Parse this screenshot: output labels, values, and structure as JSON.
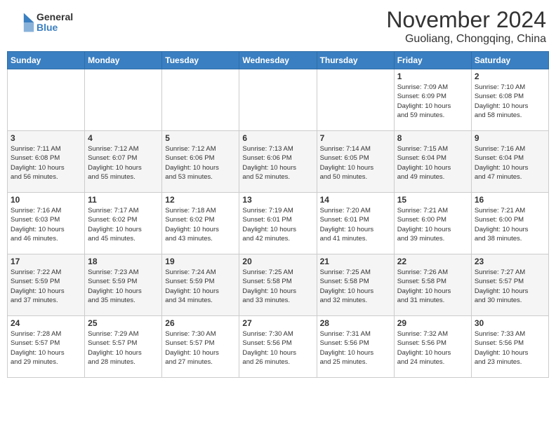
{
  "header": {
    "logo_general": "General",
    "logo_blue": "Blue",
    "month_title": "November 2024",
    "location": "Guoliang, Chongqing, China"
  },
  "weekdays": [
    "Sunday",
    "Monday",
    "Tuesday",
    "Wednesday",
    "Thursday",
    "Friday",
    "Saturday"
  ],
  "weeks": [
    [
      {
        "day": "",
        "info": ""
      },
      {
        "day": "",
        "info": ""
      },
      {
        "day": "",
        "info": ""
      },
      {
        "day": "",
        "info": ""
      },
      {
        "day": "",
        "info": ""
      },
      {
        "day": "1",
        "info": "Sunrise: 7:09 AM\nSunset: 6:09 PM\nDaylight: 10 hours\nand 59 minutes."
      },
      {
        "day": "2",
        "info": "Sunrise: 7:10 AM\nSunset: 6:08 PM\nDaylight: 10 hours\nand 58 minutes."
      }
    ],
    [
      {
        "day": "3",
        "info": "Sunrise: 7:11 AM\nSunset: 6:08 PM\nDaylight: 10 hours\nand 56 minutes."
      },
      {
        "day": "4",
        "info": "Sunrise: 7:12 AM\nSunset: 6:07 PM\nDaylight: 10 hours\nand 55 minutes."
      },
      {
        "day": "5",
        "info": "Sunrise: 7:12 AM\nSunset: 6:06 PM\nDaylight: 10 hours\nand 53 minutes."
      },
      {
        "day": "6",
        "info": "Sunrise: 7:13 AM\nSunset: 6:06 PM\nDaylight: 10 hours\nand 52 minutes."
      },
      {
        "day": "7",
        "info": "Sunrise: 7:14 AM\nSunset: 6:05 PM\nDaylight: 10 hours\nand 50 minutes."
      },
      {
        "day": "8",
        "info": "Sunrise: 7:15 AM\nSunset: 6:04 PM\nDaylight: 10 hours\nand 49 minutes."
      },
      {
        "day": "9",
        "info": "Sunrise: 7:16 AM\nSunset: 6:04 PM\nDaylight: 10 hours\nand 47 minutes."
      }
    ],
    [
      {
        "day": "10",
        "info": "Sunrise: 7:16 AM\nSunset: 6:03 PM\nDaylight: 10 hours\nand 46 minutes."
      },
      {
        "day": "11",
        "info": "Sunrise: 7:17 AM\nSunset: 6:02 PM\nDaylight: 10 hours\nand 45 minutes."
      },
      {
        "day": "12",
        "info": "Sunrise: 7:18 AM\nSunset: 6:02 PM\nDaylight: 10 hours\nand 43 minutes."
      },
      {
        "day": "13",
        "info": "Sunrise: 7:19 AM\nSunset: 6:01 PM\nDaylight: 10 hours\nand 42 minutes."
      },
      {
        "day": "14",
        "info": "Sunrise: 7:20 AM\nSunset: 6:01 PM\nDaylight: 10 hours\nand 41 minutes."
      },
      {
        "day": "15",
        "info": "Sunrise: 7:21 AM\nSunset: 6:00 PM\nDaylight: 10 hours\nand 39 minutes."
      },
      {
        "day": "16",
        "info": "Sunrise: 7:21 AM\nSunset: 6:00 PM\nDaylight: 10 hours\nand 38 minutes."
      }
    ],
    [
      {
        "day": "17",
        "info": "Sunrise: 7:22 AM\nSunset: 5:59 PM\nDaylight: 10 hours\nand 37 minutes."
      },
      {
        "day": "18",
        "info": "Sunrise: 7:23 AM\nSunset: 5:59 PM\nDaylight: 10 hours\nand 35 minutes."
      },
      {
        "day": "19",
        "info": "Sunrise: 7:24 AM\nSunset: 5:59 PM\nDaylight: 10 hours\nand 34 minutes."
      },
      {
        "day": "20",
        "info": "Sunrise: 7:25 AM\nSunset: 5:58 PM\nDaylight: 10 hours\nand 33 minutes."
      },
      {
        "day": "21",
        "info": "Sunrise: 7:25 AM\nSunset: 5:58 PM\nDaylight: 10 hours\nand 32 minutes."
      },
      {
        "day": "22",
        "info": "Sunrise: 7:26 AM\nSunset: 5:58 PM\nDaylight: 10 hours\nand 31 minutes."
      },
      {
        "day": "23",
        "info": "Sunrise: 7:27 AM\nSunset: 5:57 PM\nDaylight: 10 hours\nand 30 minutes."
      }
    ],
    [
      {
        "day": "24",
        "info": "Sunrise: 7:28 AM\nSunset: 5:57 PM\nDaylight: 10 hours\nand 29 minutes."
      },
      {
        "day": "25",
        "info": "Sunrise: 7:29 AM\nSunset: 5:57 PM\nDaylight: 10 hours\nand 28 minutes."
      },
      {
        "day": "26",
        "info": "Sunrise: 7:30 AM\nSunset: 5:57 PM\nDaylight: 10 hours\nand 27 minutes."
      },
      {
        "day": "27",
        "info": "Sunrise: 7:30 AM\nSunset: 5:56 PM\nDaylight: 10 hours\nand 26 minutes."
      },
      {
        "day": "28",
        "info": "Sunrise: 7:31 AM\nSunset: 5:56 PM\nDaylight: 10 hours\nand 25 minutes."
      },
      {
        "day": "29",
        "info": "Sunrise: 7:32 AM\nSunset: 5:56 PM\nDaylight: 10 hours\nand 24 minutes."
      },
      {
        "day": "30",
        "info": "Sunrise: 7:33 AM\nSunset: 5:56 PM\nDaylight: 10 hours\nand 23 minutes."
      }
    ]
  ]
}
